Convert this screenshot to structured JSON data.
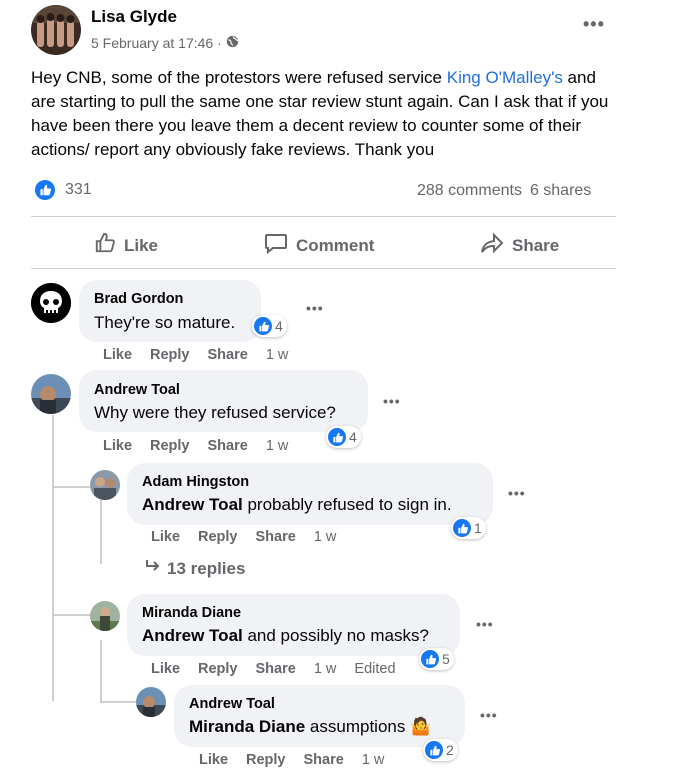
{
  "post": {
    "author": "Lisa Glyde",
    "timestamp": "5 February at 17:46 ·",
    "audience_icon": "globe-icon",
    "more_icon": "more-options-icon",
    "text_before_link": "Hey CNB, some of the protestors were refused service ",
    "link_text": "King O'Malley's",
    "text_after_link": " and are starting to pull the same one star review stunt again. Can I ask that if you have been there you leave them a decent review to counter some of their actions/ report any obviously fake reviews. Thank you",
    "like_count": "331",
    "comments_count": "288 comments",
    "shares_count": "6 shares"
  },
  "actions": {
    "like": "Like",
    "comment": "Comment",
    "share": "Share"
  },
  "comments": [
    {
      "author": "Brad Gordon",
      "text": "They're so mature.",
      "reactions": "4",
      "like": "Like",
      "reply": "Reply",
      "share": "Share",
      "time": "1 w"
    },
    {
      "author": "Andrew Toal",
      "text": "Why were they refused service?",
      "reactions": "4",
      "like": "Like",
      "reply": "Reply",
      "share": "Share",
      "time": "1 w"
    }
  ],
  "replies": [
    {
      "author": "Adam Hingston",
      "mention": "Andrew Toal",
      "text": " probably refused to sign in.",
      "reactions": "1",
      "like": "Like",
      "reply": "Reply",
      "share": "Share",
      "time": "1 w"
    },
    {
      "author": "Miranda Diane",
      "mention": "Andrew Toal",
      "text": " and possibly no masks?",
      "reactions": "5",
      "like": "Like",
      "reply": "Reply",
      "share": "Share",
      "time": "1 w",
      "edited": "Edited"
    },
    {
      "author": "Andrew Toal",
      "mention": "Miranda Diane",
      "text": " assumptions ",
      "emoji": "🤷",
      "reactions": "2",
      "like": "Like",
      "reply": "Reply",
      "share": "Share",
      "time": "1 w"
    }
  ],
  "more_replies": "13 replies",
  "colors": {
    "accent": "#1877f2",
    "link": "#216fdb",
    "muted": "#65676b",
    "bubble": "#f0f2f5"
  }
}
